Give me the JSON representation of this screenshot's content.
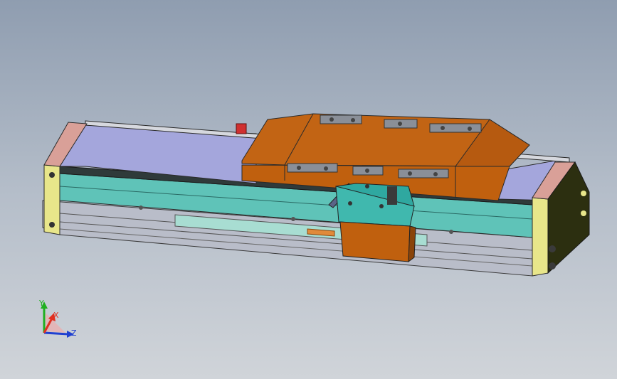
{
  "viewport": {
    "background_top": "#8f9db0",
    "background_bottom": "#d0d4d9"
  },
  "model": {
    "carriage_color": "#c0600e",
    "rail_color": "#5fc3b8",
    "end_cap_color": "#e8e68a",
    "cover_color": "#a4a6dc",
    "base_color": "#b8bcc8"
  },
  "triad": {
    "x_label": "X",
    "y_label": "Y",
    "z_label": "Z",
    "x_color": "#e03020",
    "y_color": "#20b020",
    "z_color": "#2040d0"
  }
}
